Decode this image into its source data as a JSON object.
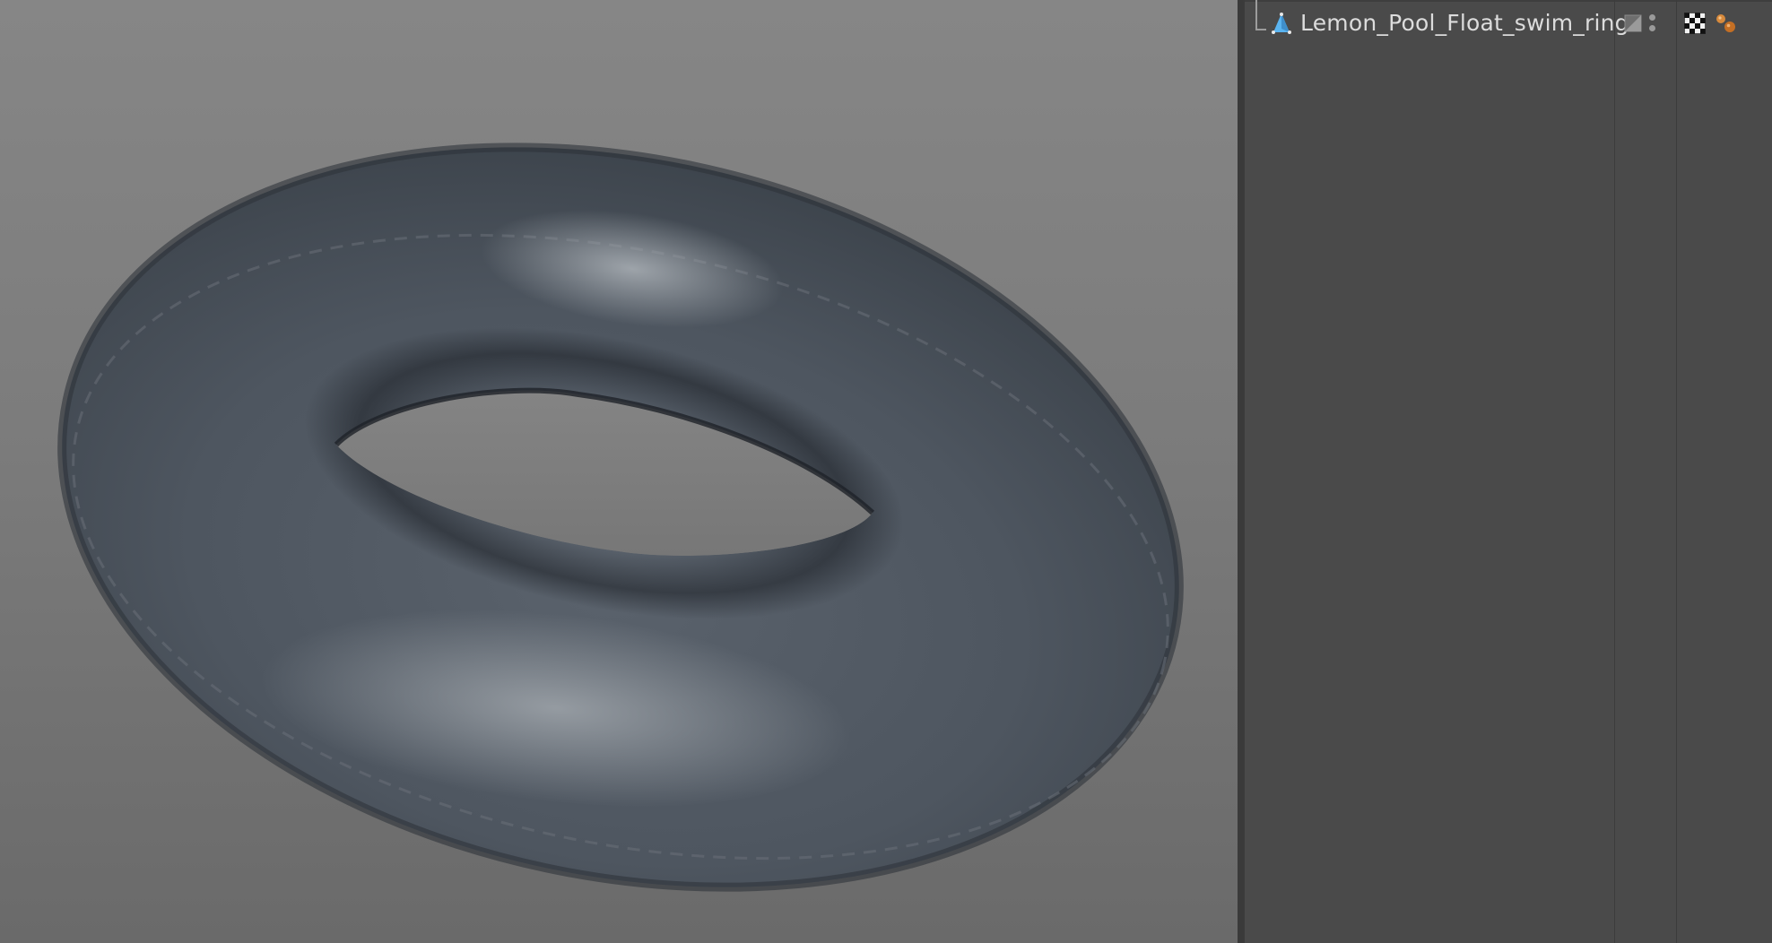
{
  "colors": {
    "viewport_bg": "#7c7c7c",
    "panel_bg": "#4a4a4a",
    "object_text": "#dcdcdc",
    "object_icon": "#5ab4f0",
    "material_tag": "#d88a3c"
  },
  "viewport": {
    "object_shape": "torus"
  },
  "object_manager": {
    "objects": [
      {
        "name": "Lemon_Pool_Float_swim_ring",
        "icon": "polygon-object-icon",
        "layer_icon": "layer-icon",
        "visibility_icon": "visibility-dots-icon",
        "tags": [
          "checker-texture-tag-icon",
          "material-tag-icon"
        ]
      }
    ]
  }
}
